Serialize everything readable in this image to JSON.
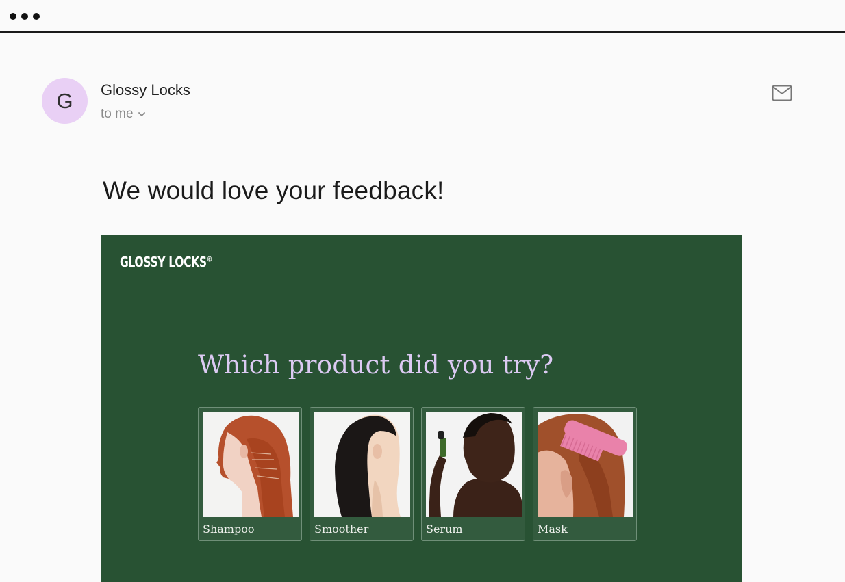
{
  "window": {
    "dots": 3
  },
  "email": {
    "sender": {
      "avatar_initial": "G",
      "name": "Glossy Locks",
      "recipient": "to me"
    },
    "subject": "We would love your feedback!"
  },
  "banner": {
    "brand": "GLOSSY LOCKS",
    "brand_mark": "©",
    "question": "Which product did you try?",
    "products": [
      {
        "label": "Shampoo"
      },
      {
        "label": "Smoother"
      },
      {
        "label": "Serum"
      },
      {
        "label": "Mask"
      }
    ]
  },
  "icons": {
    "chevron": "chevron-down-icon",
    "mail": "mail-icon"
  },
  "colors": {
    "banner_bg": "#285233",
    "question_text": "#dccaf3",
    "avatar_bg": "#e9d0f5"
  }
}
